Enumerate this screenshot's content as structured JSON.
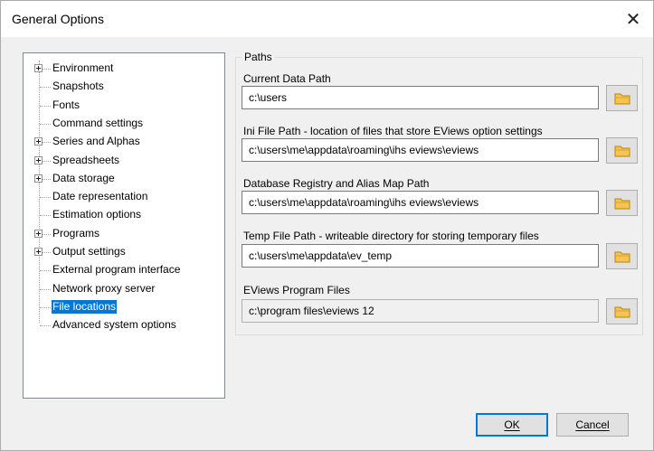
{
  "window": {
    "title": "General Options",
    "close_glyph": "✕"
  },
  "tree": {
    "items": [
      {
        "label": "Environment",
        "expandable": true
      },
      {
        "label": "Snapshots",
        "expandable": false
      },
      {
        "label": "Fonts",
        "expandable": false
      },
      {
        "label": "Command settings",
        "expandable": false
      },
      {
        "label": "Series and Alphas",
        "expandable": true
      },
      {
        "label": "Spreadsheets",
        "expandable": true
      },
      {
        "label": "Data storage",
        "expandable": true
      },
      {
        "label": "Date representation",
        "expandable": false
      },
      {
        "label": "Estimation options",
        "expandable": false
      },
      {
        "label": "Programs",
        "expandable": true
      },
      {
        "label": "Output settings",
        "expandable": true
      },
      {
        "label": "External program interface",
        "expandable": false
      },
      {
        "label": "Network proxy server",
        "expandable": false
      },
      {
        "label": "File locations",
        "expandable": false,
        "selected": true
      },
      {
        "label": "Advanced system options",
        "expandable": false
      }
    ]
  },
  "paths": {
    "caption": "Paths",
    "fields": [
      {
        "label": "Current Data Path",
        "value": "c:\\users",
        "disabled": false
      },
      {
        "label": "Ini File Path - location of files that store EViews option settings",
        "value": "c:\\users\\me\\appdata\\roaming\\ihs eviews\\eviews",
        "disabled": false
      },
      {
        "label": "Database Registry and Alias Map Path",
        "value": "c:\\users\\me\\appdata\\roaming\\ihs eviews\\eviews",
        "disabled": false
      },
      {
        "label": "Temp File Path  -  writeable directory for storing temporary files",
        "value": "c:\\users\\me\\appdata\\ev_temp",
        "disabled": false
      },
      {
        "label": "EViews Program Files",
        "value": "c:\\program files\\eviews 12",
        "disabled": true
      }
    ]
  },
  "buttons": {
    "ok": "OK",
    "cancel": "Cancel"
  },
  "colors": {
    "selection": "#0078d7",
    "folder": "#f5c453"
  }
}
